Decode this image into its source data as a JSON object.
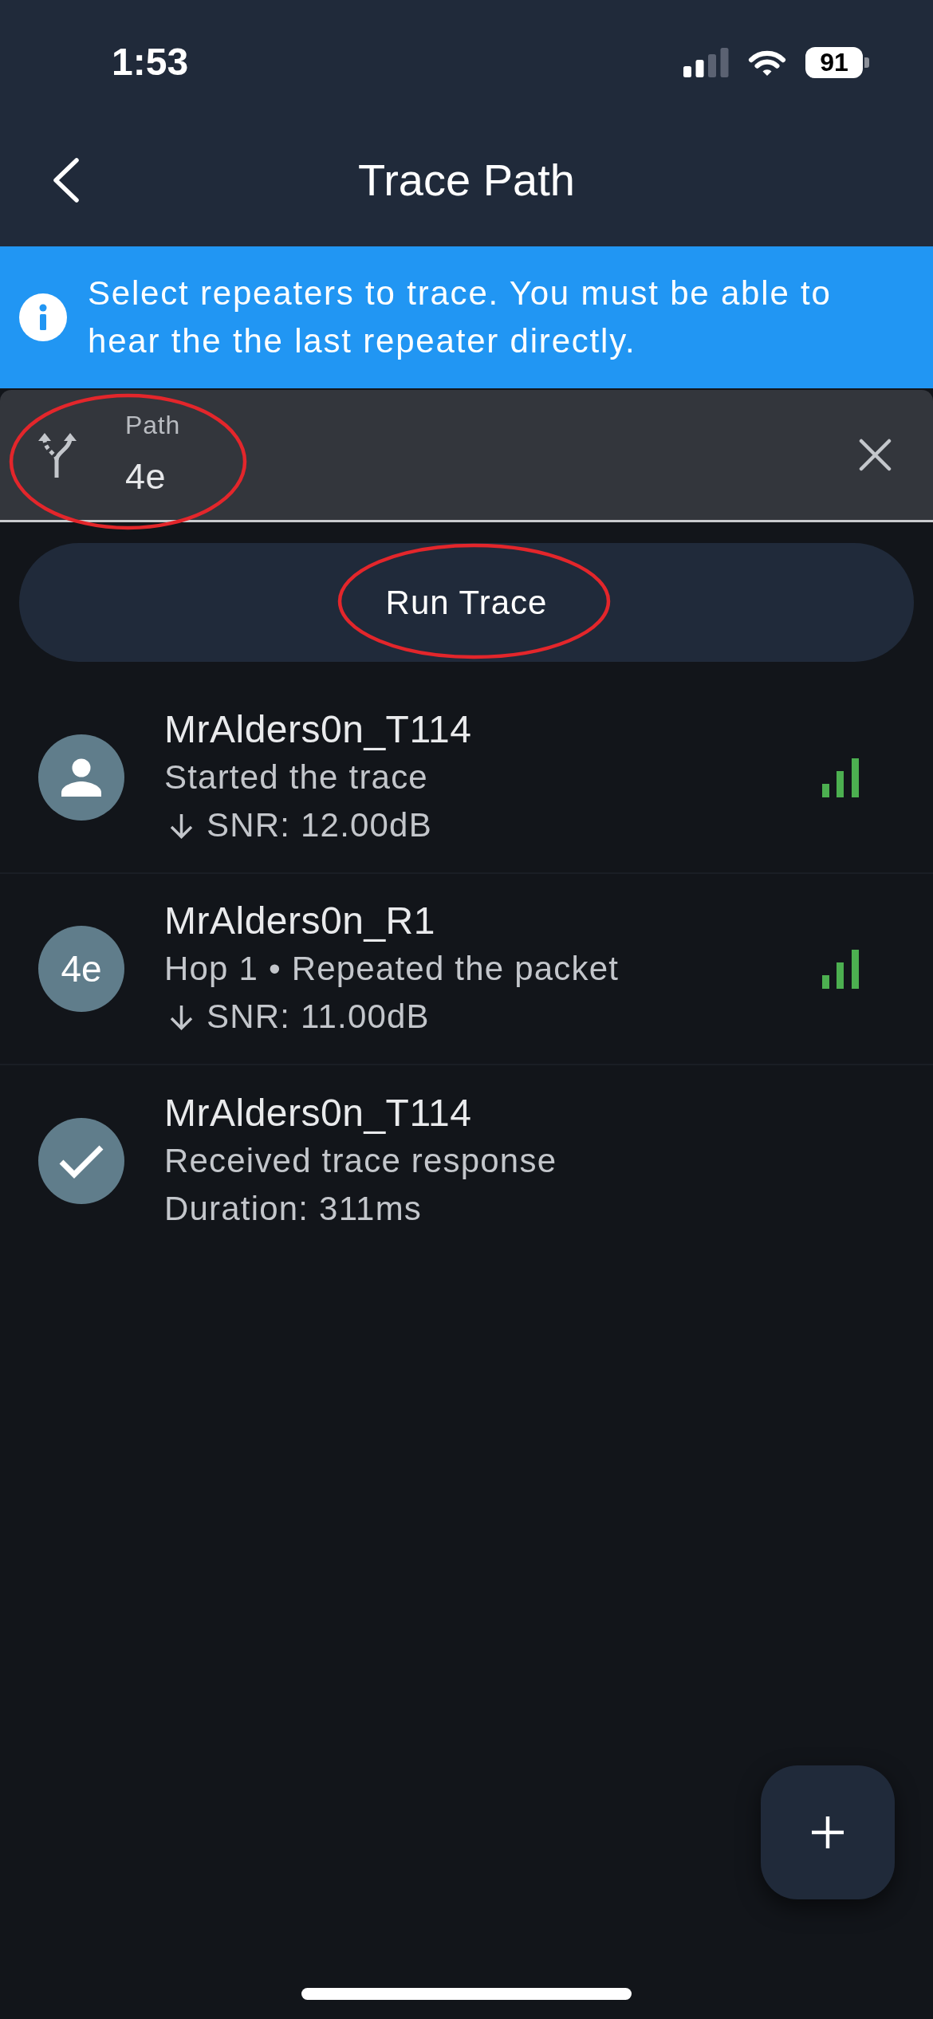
{
  "status_bar": {
    "time": "1:53",
    "battery": "91"
  },
  "header": {
    "title": "Trace Path"
  },
  "banner": {
    "text": "Select repeaters to trace. You must be able to hear the the last repeater directly."
  },
  "path_field": {
    "label": "Path",
    "value": "4e",
    "circled": true
  },
  "run_button": {
    "label": "Run Trace",
    "circled": true
  },
  "hops": [
    {
      "kind": "person",
      "name": "MrAlders0n_T114",
      "detail": "Started the trace",
      "stat": {
        "kind": "snr",
        "text": "SNR: 12.00dB"
      },
      "signal": true
    },
    {
      "kind": "badge",
      "badge": "4e",
      "name": "MrAlders0n_R1",
      "detail": "Hop 1 • Repeated the packet",
      "stat": {
        "kind": "snr",
        "text": "SNR: 11.00dB"
      },
      "signal": true
    },
    {
      "kind": "check",
      "name": "MrAlders0n_T114",
      "detail": "Received trace response",
      "stat": {
        "kind": "duration",
        "text": "Duration: 311ms"
      },
      "signal": false
    }
  ]
}
